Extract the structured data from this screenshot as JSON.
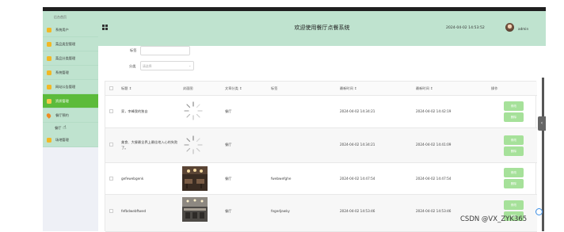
{
  "sidebar": {
    "head": "后台首页",
    "items": [
      {
        "label": "系统用户"
      },
      {
        "label": "菜品类型管理"
      },
      {
        "label": "菜品分类管理"
      },
      {
        "label": "系统管理"
      },
      {
        "label": "网站公告管理"
      },
      {
        "label": "资质管理"
      },
      {
        "label": "餐厅预约"
      },
      {
        "label": "餐厅"
      },
      {
        "label": "场地管理"
      }
    ]
  },
  "header": {
    "title": "欢迎使用餐厅点餐系统",
    "datetime": "2024-04-02 14:53:52",
    "user": "admin"
  },
  "search": {
    "title_label": "标签",
    "category_label": "分类",
    "category_placeholder": "请选择"
  },
  "table": {
    "columns": [
      "标题 ↕",
      "封面图",
      "文章分类 ↕",
      "标签",
      "最新时间 ↕",
      "最新时间 ↕",
      "操作"
    ],
    "rows": [
      {
        "title": "家，李峰我的独自",
        "category": "餐厅",
        "tag": "",
        "time1": "2024-04-02 14:34:21",
        "time2": "2024-04-02 14:42:19",
        "image": "loading"
      },
      {
        "title": "美食、大餐最全界上最佳地入心的失败了。",
        "category": "餐厅",
        "tag": "",
        "time1": "2024-04-02 14:34:21",
        "time2": "2024-04-02 14:41:09",
        "image": "loading"
      },
      {
        "title": "gefewebgenk",
        "category": "餐厅",
        "tag": "fwebwefghe",
        "time1": "2024-04-02 14:47:54",
        "time2": "2024-04-02 14:47:54",
        "image": "restaurant"
      },
      {
        "title": "fefbdwebftwed",
        "category": "餐厅",
        "tag": "fegedjewky",
        "time1": "2024-04-02 14:53:46",
        "time2": "2024-04-02 14:53:46",
        "image": "hall"
      }
    ],
    "btn_edit": "修改",
    "btn_delete": "删除"
  },
  "watermark": "CSDN @VX_ZYK365",
  "colors": {
    "header_bg": "#bfe3cf",
    "active_item": "#5cbb3b",
    "button": "#a6e19a"
  }
}
